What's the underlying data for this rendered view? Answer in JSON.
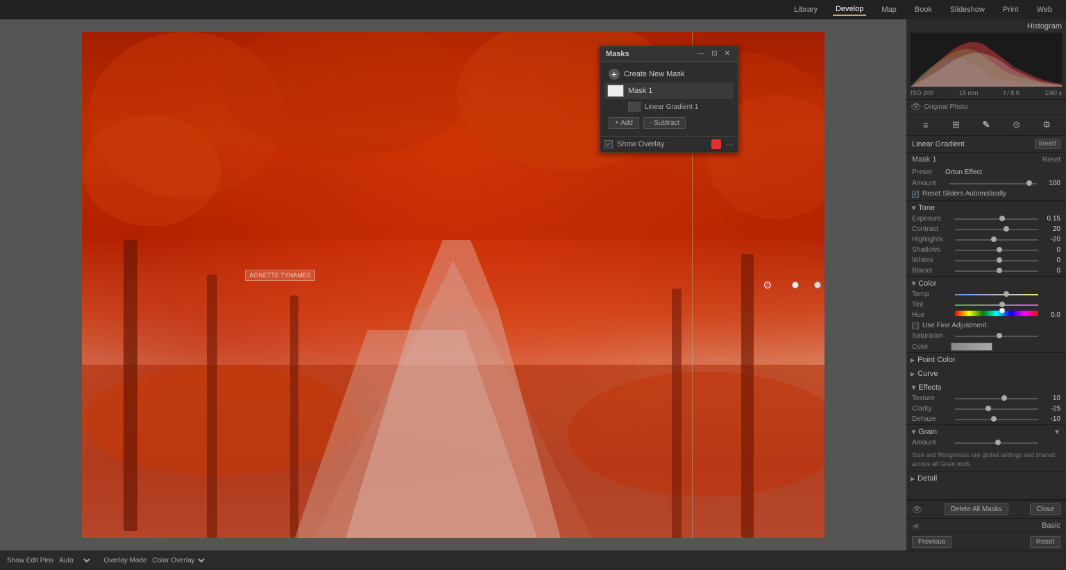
{
  "topMenu": {
    "items": [
      "Library",
      "Develop",
      "Map",
      "Book",
      "Slideshow",
      "Print",
      "Web"
    ],
    "active": "Develop"
  },
  "histogram": {
    "title": "Histogram",
    "iso": "ISO 200",
    "mm": "15 mm",
    "aperture": "f / 8.0",
    "shutter": "1/60 s",
    "originalPhoto": "Original Photo"
  },
  "tools": {
    "icons": [
      "☰",
      "⊞",
      "✎",
      "⊙",
      "⚙"
    ]
  },
  "linearGradient": {
    "title": "Linear Gradient",
    "invertLabel": "Invert",
    "maskName": "Mask 1",
    "resetLabel": "Reset",
    "preset": {
      "label": "Preset",
      "value": "Orton Effect"
    },
    "amount": {
      "label": "Amount",
      "value": "100",
      "thumbPos": "90%"
    },
    "resetSliders": "Reset Sliders Automatically"
  },
  "tone": {
    "title": "Tone",
    "value": "",
    "sliders": [
      {
        "label": "Exposure",
        "value": "0.15",
        "pos": "55%"
      },
      {
        "label": "Contrast",
        "value": "20",
        "pos": "60%"
      },
      {
        "label": "Highlights",
        "value": "-20",
        "pos": "44%"
      },
      {
        "label": "Shadows",
        "value": "0",
        "pos": "50%"
      },
      {
        "label": "Whites",
        "value": "0",
        "pos": "50%"
      },
      {
        "label": "Blacks",
        "value": "0",
        "pos": "50%"
      }
    ]
  },
  "color": {
    "title": "Color",
    "sliders": [
      {
        "label": "Temp",
        "value": "",
        "pos": "60%",
        "special": "temp"
      },
      {
        "label": "Tint",
        "value": "",
        "pos": "55%",
        "special": "tint"
      },
      {
        "label": "Hue",
        "value": "0.0",
        "pos": "55%",
        "special": "hue"
      },
      {
        "label": "Saturation",
        "value": "",
        "pos": "52%",
        "special": "none"
      }
    ],
    "fineTuning": "Use Fine Adjustment",
    "colorLabel": "Color",
    "colorSwatch": "#888"
  },
  "pointColor": {
    "title": "Point Color"
  },
  "curve": {
    "title": "Curve"
  },
  "effects": {
    "title": "Effects",
    "sliders": [
      {
        "label": "Texture",
        "value": "10",
        "pos": "58%"
      },
      {
        "label": "Clarity",
        "value": "-25",
        "pos": "36%"
      },
      {
        "label": "Dehaze",
        "value": "-10",
        "pos": "44%"
      }
    ]
  },
  "grain": {
    "title": "Grain",
    "amount": {
      "label": "Amount",
      "value": "",
      "pos": "50%"
    }
  },
  "grainNote": "Size and Roughness are global settings and shared across all Grain tools",
  "detail": {
    "title": "Detail"
  },
  "masks": {
    "panelTitle": "Masks",
    "createNewMask": "Create New Mask",
    "mask1": {
      "name": "Mask 1",
      "subItem": "Linear Gradient 1"
    },
    "addLabel": "+ Add",
    "subtractLabel": "- Subtract",
    "showOverlay": "Show Overlay",
    "deleteAllMasks": "Delete All Masks",
    "close": "Close"
  },
  "bottomBar": {
    "showEditPins": "Show Edit Pins",
    "auto": "Auto",
    "overlayMode": "Overlay Mode",
    "colorOverlay": "Color Overlay"
  },
  "rightPanelBottom": {
    "previousLabel": "Previous",
    "resetLabel": "Reset",
    "basicLabel": "Basic"
  },
  "sign": "AONETTE TYNAMES"
}
